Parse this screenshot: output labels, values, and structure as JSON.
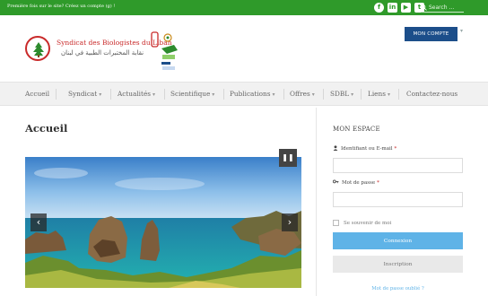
{
  "topbar": {
    "notice": "Première fois sur le site? Créez un compte (g) !",
    "social": {
      "facebook": "f",
      "linkedin": "in",
      "youtube": "▶",
      "twitter": "t"
    },
    "search_placeholder": "Search ..."
  },
  "header": {
    "site_name": "Syndicat des Biologistes du Liban",
    "site_name_ar": "نقابة المختبرات الطبية في لبنان",
    "account_button": "MON COMPTE"
  },
  "nav": {
    "items": [
      {
        "label": "Accueil",
        "dropdown": false
      },
      {
        "label": "Syndicat",
        "dropdown": true
      },
      {
        "label": "Actualités",
        "dropdown": true
      },
      {
        "label": "Scientifique",
        "dropdown": true
      },
      {
        "label": "Publications",
        "dropdown": true
      },
      {
        "label": "Offres",
        "dropdown": true
      },
      {
        "label": "SDBL",
        "dropdown": true
      },
      {
        "label": "Liens",
        "dropdown": true
      },
      {
        "label": "Contactez-nous",
        "dropdown": false
      }
    ]
  },
  "main": {
    "title": "Accueil",
    "slider": {
      "pause": "❚❚",
      "prev": "‹",
      "next": "›"
    }
  },
  "sidebar": {
    "title": "MON ESPACE",
    "username_label": "Identifiant ou E-mail",
    "username_value": "",
    "password_label": "Mot de passe",
    "password_value": "",
    "required_mark": "*",
    "remember_label": "Se souvenir de moi",
    "login_button": "Connexion",
    "signup_button": "Inscription",
    "forgot_link": "Mot de passe oublié ?"
  },
  "colors": {
    "topbar": "#2f9a2a",
    "account_button": "#1c4e8a",
    "login_button": "#5fb3e7",
    "brand_red": "#c92a2a"
  }
}
